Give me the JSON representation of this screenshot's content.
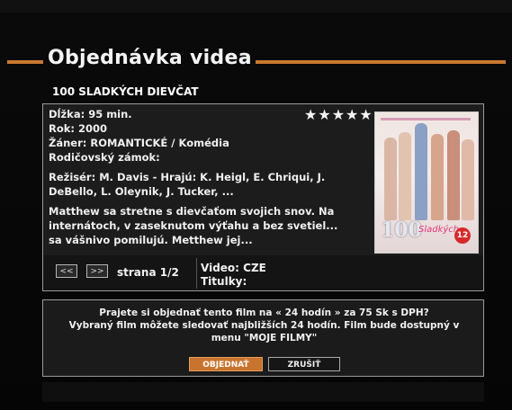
{
  "header": {
    "title": "Objednávka videa",
    "movie_title": "100 SLADKÝCH DIEVČAT"
  },
  "details": {
    "length": "Dĺžka: 95 min.",
    "year": "Rok: 2000",
    "genre": "Žáner: ROMANTICKÉ / Komédia",
    "parental_lock": "Rodičovský zámok:",
    "credits_line1": "Režisér: M. Davis - Hrajú: K. Heigl, E. Chriqui, J.",
    "credits_line2": "DeBello, L. Oleynik, J. Tucker, ...",
    "synopsis_line1": "Matthew sa stretne s dievčaťom svojich snov. Na",
    "synopsis_line2": "internátoch, v zaseknutom výťahu a bez svetiel...",
    "synopsis_line3": "sa vášnivo pomilujú. Metthew jej...",
    "rating_stars": "★★★★★",
    "rating_value": 5
  },
  "poster": {
    "logo_number": "100",
    "logo_script": "Sladkých",
    "age_badge": "12"
  },
  "navigation": {
    "prev_label": "<<",
    "next_label": ">>",
    "page_label": "strana 1/2",
    "video_label": "Video: CZE",
    "subtitles_label": "Titulky:"
  },
  "confirm": {
    "line1": "Prajete si objednať tento film na « 24 hodín » za 75 Sk s DPH?",
    "line2": "Vybraný film môžete sledovať najbližších 24 hodín. Film bude dostupný v",
    "line3": "menu \"MOJE FILMY\"",
    "order_label": "OBJEDNAŤ",
    "cancel_label": "ZRUŠIŤ"
  },
  "colors": {
    "accent": "#c8742e",
    "background": "#050505",
    "panel": "#1c1c1c"
  }
}
